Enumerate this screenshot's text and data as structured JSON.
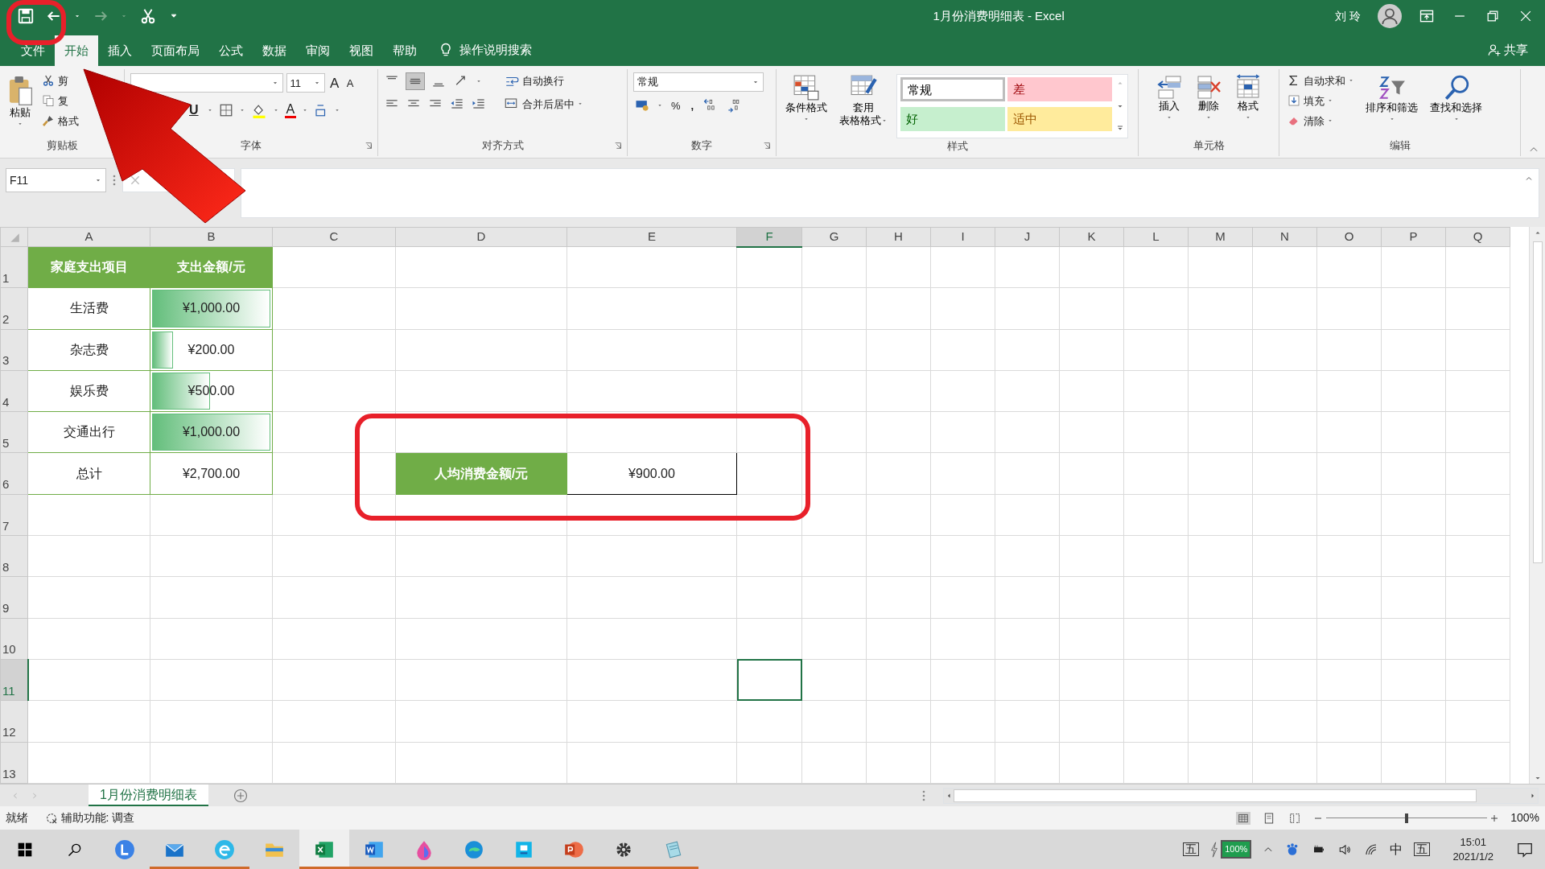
{
  "title_bar": {
    "title": "1月份消费明细表  -  Excel",
    "user": "刘 玲"
  },
  "menu_tabs": [
    {
      "label": "文件",
      "selected": false
    },
    {
      "label": "开始",
      "selected": true
    },
    {
      "label": "插入",
      "selected": false
    },
    {
      "label": "页面布局",
      "selected": false
    },
    {
      "label": "公式",
      "selected": false
    },
    {
      "label": "数据",
      "selected": false
    },
    {
      "label": "审阅",
      "selected": false
    },
    {
      "label": "视图",
      "selected": false
    },
    {
      "label": "帮助",
      "selected": false
    }
  ],
  "tell_me": "操作说明搜索",
  "share": "共享",
  "ribbon": {
    "clipboard": {
      "paste": "粘贴",
      "items": [
        "剪",
        "复",
        "格式"
      ],
      "label": "剪贴板"
    },
    "font": {
      "size": "11",
      "grow": "A",
      "shrink": "A",
      "underline": "U",
      "font_color": "A",
      "label": "字体"
    },
    "alignment": {
      "wrap": "自动换行",
      "merge": "合并后居中",
      "label": "对齐方式"
    },
    "number": {
      "format": "常规",
      "percent": "%",
      "comma": ",",
      "label": "数字"
    },
    "styles": {
      "conditional": "条件格式",
      "table_format": [
        "套用",
        "表格格式"
      ],
      "gallery": [
        {
          "label": "常规",
          "kind": "normal",
          "selected": true
        },
        {
          "label": "差",
          "kind": "bad",
          "selected": false
        },
        {
          "label": "好",
          "kind": "good",
          "selected": false
        },
        {
          "label": "适中",
          "kind": "neutral",
          "selected": false
        }
      ],
      "label": "样式"
    },
    "cells": {
      "buttons": [
        "插入",
        "删除",
        "格式"
      ],
      "label": "单元格"
    },
    "editing": {
      "autosum": "自动求和",
      "fill": "填充",
      "clear": "清除",
      "sort": "排序和筛选",
      "find": "查找和选择",
      "label": "编辑"
    }
  },
  "name_box": "F11",
  "sheet": {
    "columns": [
      {
        "label": "A",
        "selected": false
      },
      {
        "label": "B",
        "selected": false
      },
      {
        "label": "C",
        "selected": false
      },
      {
        "label": "D",
        "selected": false
      },
      {
        "label": "E",
        "selected": false
      },
      {
        "label": "F",
        "selected": true
      },
      {
        "label": "G",
        "selected": false
      },
      {
        "label": "H",
        "selected": false
      },
      {
        "label": "I",
        "selected": false
      },
      {
        "label": "J",
        "selected": false
      },
      {
        "label": "K",
        "selected": false
      },
      {
        "label": "L",
        "selected": false
      },
      {
        "label": "M",
        "selected": false
      },
      {
        "label": "N",
        "selected": false
      },
      {
        "label": "O",
        "selected": false
      },
      {
        "label": "P",
        "selected": false
      },
      {
        "label": "Q",
        "selected": false
      }
    ],
    "rows": [
      {
        "label": "1",
        "selected": false,
        "cells": [
          {
            "kind": "heading",
            "text": "家庭支出项目"
          },
          {
            "kind": "heading",
            "text": "支出金额/元"
          }
        ]
      },
      {
        "label": "2",
        "selected": false,
        "cells": [
          {
            "kind": "text",
            "text": "生活费"
          },
          {
            "kind": "bar",
            "text": "¥1,000.00",
            "level": 1.0
          }
        ]
      },
      {
        "label": "3",
        "selected": false,
        "cells": [
          {
            "kind": "text",
            "text": "杂志费"
          },
          {
            "kind": "bar",
            "text": "¥200.00",
            "level": 0.2
          }
        ]
      },
      {
        "label": "4",
        "selected": false,
        "cells": [
          {
            "kind": "text",
            "text": "娱乐费"
          },
          {
            "kind": "bar",
            "text": "¥500.00",
            "level": 0.5
          }
        ]
      },
      {
        "label": "5",
        "selected": false,
        "cells": [
          {
            "kind": "text",
            "text": "交通出行"
          },
          {
            "kind": "bar",
            "text": "¥1,000.00",
            "level": 1.0
          }
        ]
      },
      {
        "label": "6",
        "selected": false,
        "cells": [
          {
            "kind": "text",
            "text": "总计"
          },
          {
            "kind": "text",
            "text": "¥2,700.00"
          },
          "",
          {
            "kind": "heading",
            "text": "人均消费金额/元"
          },
          {
            "kind": "boxed",
            "text": "¥900.00"
          }
        ]
      },
      {
        "label": "7",
        "selected": false,
        "cells": []
      },
      {
        "label": "8",
        "selected": false,
        "cells": []
      },
      {
        "label": "9",
        "selected": false,
        "cells": []
      },
      {
        "label": "10",
        "selected": false,
        "cells": []
      },
      {
        "label": "11",
        "selected": true,
        "cells": [
          "",
          "",
          "",
          "",
          "",
          {
            "kind": "active"
          }
        ]
      },
      {
        "label": "12",
        "selected": false,
        "cells": []
      },
      {
        "label": "13",
        "selected": false,
        "cells": []
      }
    ]
  },
  "sheet_tabs": [
    {
      "label": "1月份消费明细表",
      "selected": true
    }
  ],
  "status_bar": {
    "ready": "就绪",
    "accessibility": "辅助功能: 调查",
    "zoom": {
      "level": 0.5,
      "reading": "100%"
    }
  },
  "taskbar": {
    "apps": [
      {
        "running": false,
        "selected": false
      },
      {
        "running": true,
        "selected": false
      },
      {
        "running": true,
        "selected": false
      },
      {
        "running": false,
        "selected": false
      },
      {
        "running": true,
        "selected": true
      },
      {
        "running": true,
        "selected": false
      },
      {
        "running": true,
        "selected": false
      },
      {
        "running": true,
        "selected": false
      },
      {
        "running": true,
        "selected": false
      },
      {
        "running": true,
        "selected": false
      },
      {
        "running": true,
        "selected": false
      },
      {
        "running": true,
        "selected": false
      }
    ],
    "ime_left": "五",
    "battery": "100%",
    "language": "中",
    "ime_right": "五",
    "time": "15:01",
    "date": "2021/1/2"
  },
  "annotations": [
    {
      "kind": "outline"
    },
    {
      "kind": "outline"
    },
    {
      "kind": "arrow"
    }
  ]
}
